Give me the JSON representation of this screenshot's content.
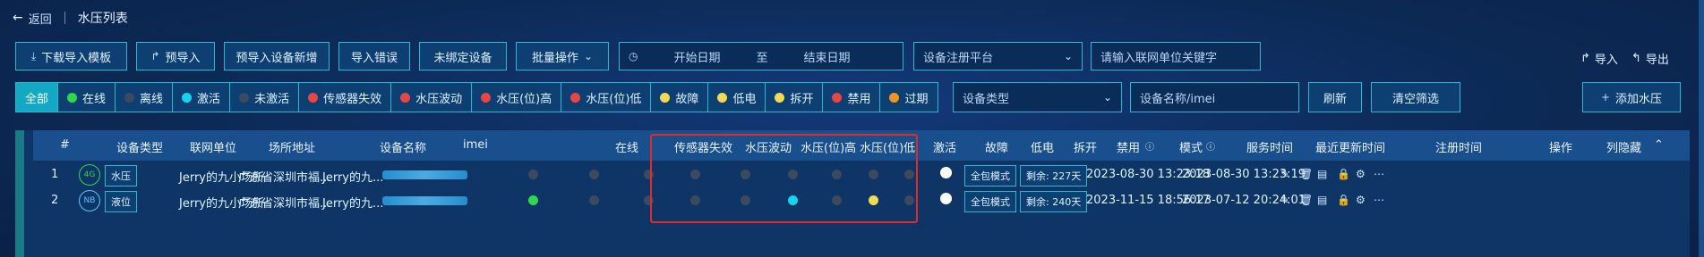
{
  "header": {
    "back_label": "返回",
    "page_title": "水压列表"
  },
  "toolbar": {
    "buttons": [
      "下载导入模板",
      "预导入",
      "预导入设备新增",
      "导入错误",
      "未绑定设备",
      "批量操作"
    ],
    "date_start_placeholder": "开始日期",
    "date_to": "至",
    "date_end_placeholder": "结束日期",
    "platform_select": "设备注册平台",
    "unit_keyword_placeholder": "请输入联网单位关键字",
    "import_label": "导入",
    "export_label": "导出"
  },
  "filters": {
    "tabs": [
      {
        "label": "全部",
        "color": ""
      },
      {
        "label": "在线",
        "color": "#2ed84b"
      },
      {
        "label": "离线",
        "color": "#3b4a5f"
      },
      {
        "label": "激活",
        "color": "#14d5ef"
      },
      {
        "label": "未激活",
        "color": "#3b4a5f"
      },
      {
        "label": "传感器失效",
        "color": "#e84545"
      },
      {
        "label": "水压波动",
        "color": "#e84545"
      },
      {
        "label": "水压(位)高",
        "color": "#e84545"
      },
      {
        "label": "水压(位)低",
        "color": "#e84545"
      },
      {
        "label": "故障",
        "color": "#f2da55"
      },
      {
        "label": "低电",
        "color": "#f2da55"
      },
      {
        "label": "拆开",
        "color": "#f2da55"
      },
      {
        "label": "禁用",
        "color": "#e84545"
      },
      {
        "label": "过期",
        "color": "#f29421"
      }
    ],
    "device_type_select": "设备类型",
    "device_name_placeholder": "设备名称/imei",
    "refresh_label": "刷新",
    "clear_label": "清空筛选",
    "add_label": "添加水压"
  },
  "table": {
    "columns": [
      "#",
      "设备类型",
      "联网单位",
      "场所地址",
      "设备名称",
      "imei",
      "在线",
      "传感器失效",
      "水压波动",
      "水压(位)高",
      "水压(位)低",
      "激活",
      "故障",
      "低电",
      "拆开",
      "禁用",
      "模式",
      "服务时间",
      "最近更新时间",
      "注册时间",
      "操作",
      "列隐藏"
    ],
    "rows": [
      {
        "index": "1",
        "network": "4G",
        "network_color": "#2ed84b",
        "type": "水压",
        "unit": "Jerry的九小场所",
        "address": "广东省深圳市福...",
        "name": "Jerry的九...",
        "online_color": "#3b4a5f",
        "active_color": "#3b4a5f",
        "low_battery_color": "#3b4a5f",
        "mode": "全包模式",
        "service": "剩余: 227天",
        "updated": "2023-08-30 13:23:18",
        "registered": "2023-08-30 13:23:19"
      },
      {
        "index": "2",
        "network": "NB",
        "network_color": "#5ec7ff",
        "type": "液位",
        "unit": "Jerry的九小场所",
        "address": "广东省深圳市福...",
        "name": "Jerry的九...",
        "online_color": "#2ed84b",
        "active_color": "#14d5ef",
        "low_battery_color": "#f2da55",
        "mode": "全包模式",
        "service": "剩余: 240天",
        "updated": "2023-11-15 18:56:17",
        "registered": "2023-07-12 20:24:01"
      }
    ]
  }
}
